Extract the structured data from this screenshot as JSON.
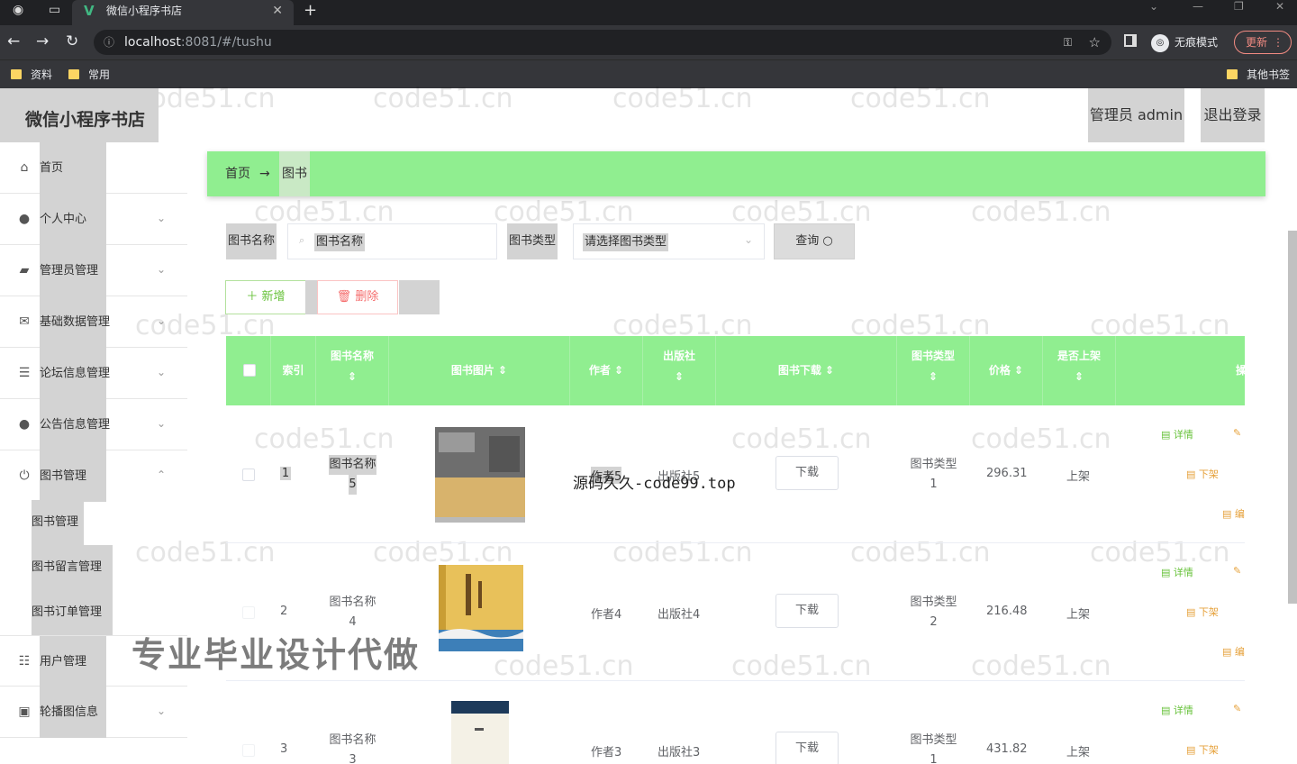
{
  "browser": {
    "tab_title": "微信小程序书店",
    "url_host": "localhost",
    "url_path": ":8081/#/tushu",
    "incognito_label": "无痕模式",
    "update_label": "更新",
    "bookmarks": [
      "资料",
      "常用"
    ],
    "other_bookmarks": "其他书签"
  },
  "header": {
    "brand": "微信小程序书店",
    "admin_label": "管理员 admin",
    "logout_label": "退出登录"
  },
  "sidebar": {
    "items": [
      {
        "label": "首页",
        "icon": "home-icon"
      },
      {
        "label": "个人中心",
        "icon": "user-icon"
      },
      {
        "label": "管理员管理",
        "icon": "admin-icon"
      },
      {
        "label": "基础数据管理",
        "icon": "mail-icon"
      },
      {
        "label": "论坛信息管理",
        "icon": "list-icon"
      },
      {
        "label": "公告信息管理",
        "icon": "user-icon"
      },
      {
        "label": "图书管理",
        "icon": "power-icon"
      },
      {
        "label": "用户管理",
        "icon": "sliders-icon"
      },
      {
        "label": "轮播图信息",
        "icon": "image-icon"
      }
    ],
    "sub_items": [
      "图书管理",
      "图书留言管理",
      "图书订单管理"
    ]
  },
  "breadcrumb": {
    "home": "首页",
    "current": "图书"
  },
  "search": {
    "name_label": "图书名称",
    "name_placeholder": "图书名称",
    "type_label": "图书类型",
    "type_placeholder": "请选择图书类型",
    "query_label": "查询"
  },
  "actions": {
    "add_label": "＋ 新增",
    "delete_label": "删除"
  },
  "table": {
    "headers": {
      "index": "索引",
      "name": [
        "图书名称",
        "⇕"
      ],
      "image": "图书图片 ⇕",
      "author": "作者 ⇕",
      "publisher": [
        "出版社",
        "⇕"
      ],
      "download": "图书下载 ⇕",
      "type": [
        "图书类型",
        "⇕"
      ],
      "price": "价格 ⇕",
      "listed": [
        "是否上架",
        "⇕"
      ],
      "more": "操"
    },
    "rows": [
      {
        "index": "1",
        "name": [
          "图书名称",
          "5"
        ],
        "author": "作者5",
        "publisher": "出版社5",
        "download": "下载",
        "type": [
          "图书类型",
          "1"
        ],
        "price": "296.31",
        "listed": "上架"
      },
      {
        "index": "2",
        "name": [
          "图书名称",
          "4"
        ],
        "author": "作者4",
        "publisher": "出版社4",
        "download": "下载",
        "type": [
          "图书类型",
          "2"
        ],
        "price": "216.48",
        "listed": "上架"
      },
      {
        "index": "3",
        "name": [
          "图书名称",
          "3"
        ],
        "author": "作者3",
        "publisher": "出版社3",
        "download": "下载",
        "type": [
          "图书类型",
          "1"
        ],
        "price": "431.82",
        "listed": "上架"
      }
    ],
    "row_actions": {
      "detail": "详情",
      "unlist": "下架",
      "edit": "编"
    }
  },
  "watermarks": {
    "tile": "code51.cn",
    "overlay_big": "专业毕业设计代做",
    "overlay_code": "源码久久-code99.top"
  }
}
